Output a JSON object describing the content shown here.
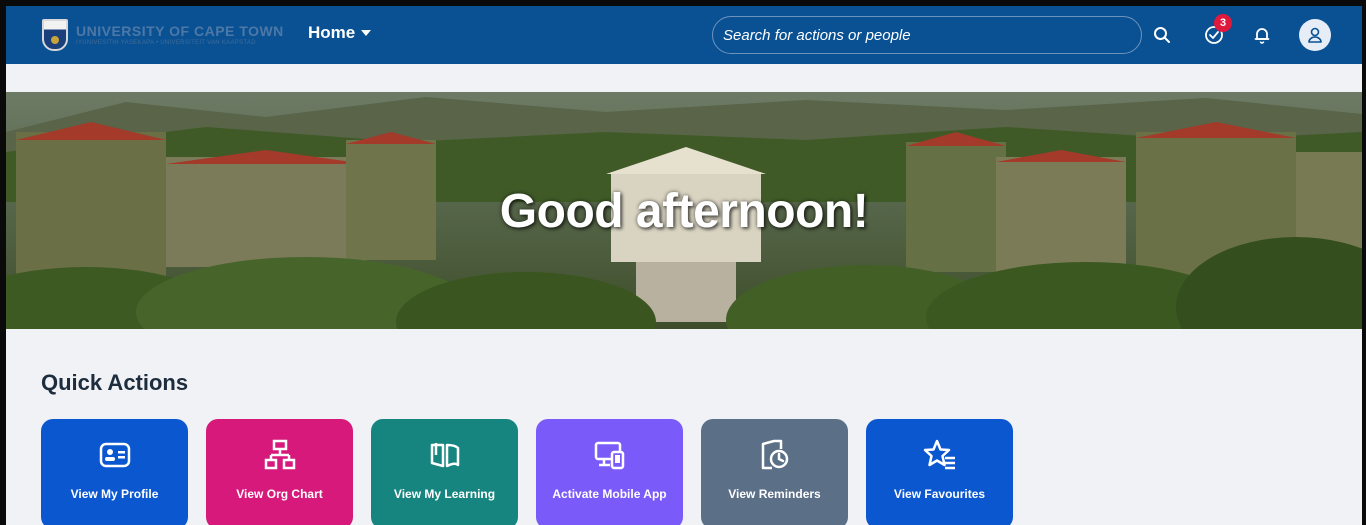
{
  "header": {
    "logo_text": "UNIVERSITY OF CAPE TOWN",
    "logo_subtext": "IYUNIVESITHI YASEKAPA • UNIVERSITEIT VAN KAAPSTAD",
    "home_menu_label": "Home",
    "search_placeholder": "Search for actions or people",
    "notification_badge_count": "3",
    "colors": {
      "shellbar": "#0a5194",
      "badge": "#e0183b"
    }
  },
  "hero": {
    "greeting": "Good afternoon!"
  },
  "quick_actions": {
    "title": "Quick Actions",
    "tiles": [
      {
        "label": "View My Profile",
        "icon": "profile-card-icon",
        "color": "#0b57d0"
      },
      {
        "label": "View Org Chart",
        "icon": "org-chart-icon",
        "color": "#d6197a"
      },
      {
        "label": "View My Learning",
        "icon": "open-book-icon",
        "color": "#17857f"
      },
      {
        "label": "Activate Mobile App",
        "icon": "devices-icon",
        "color": "#7a5af8"
      },
      {
        "label": "View Reminders",
        "icon": "reminder-clock-icon",
        "color": "#5b6f87"
      },
      {
        "label": "View Favourites",
        "icon": "star-list-icon",
        "color": "#0b57d0"
      }
    ]
  }
}
